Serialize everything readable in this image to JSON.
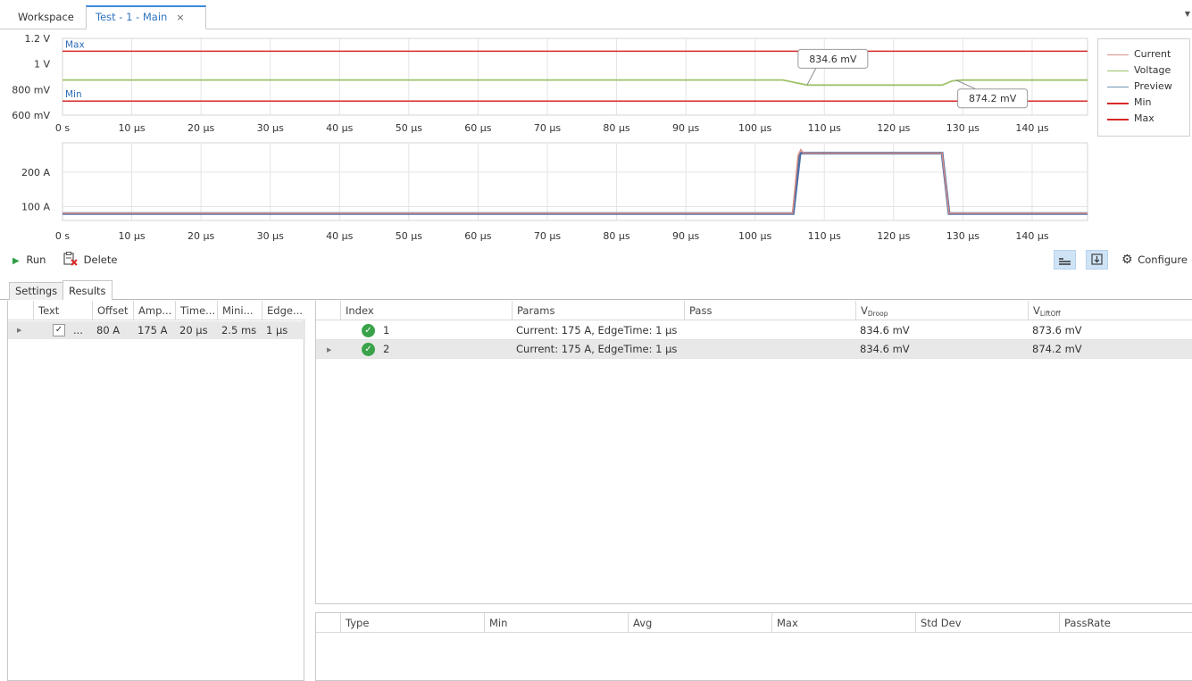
{
  "tabs": {
    "workspace": "Workspace",
    "main": "Test - 1 - Main",
    "close": "×"
  },
  "legend": [
    {
      "name": "Current",
      "color": "#d98f84"
    },
    {
      "name": "Voltage",
      "color": "#9ec36a"
    },
    {
      "name": "Preview",
      "color": "#6f93b5"
    },
    {
      "name": "Min",
      "color": "#d62828"
    },
    {
      "name": "Max",
      "color": "#d62828"
    }
  ],
  "chart_data": [
    {
      "type": "line",
      "xlim": [
        0,
        148
      ],
      "x_ticks": [
        "0 s",
        "10 µs",
        "20 µs",
        "30 µs",
        "40 µs",
        "50 µs",
        "60 µs",
        "70 µs",
        "80 µs",
        "90 µs",
        "100 µs",
        "110 µs",
        "120 µs",
        "130 µs",
        "140 µs"
      ],
      "y_ticks": [
        {
          "label": "1.2 V",
          "v": 1.2
        },
        {
          "label": "1 V",
          "v": 1.0
        },
        {
          "label": "800 mV",
          "v": 0.8
        },
        {
          "label": "600 mV",
          "v": 0.6
        }
      ],
      "ylim": [
        0.6,
        1.2
      ],
      "limit_lines": [
        {
          "label": "Max",
          "v": 1.1
        },
        {
          "label": "Min",
          "v": 0.71
        }
      ],
      "series": [
        {
          "name": "Voltage",
          "x": [
            0,
            104,
            107.5,
            108,
            127,
            128.5,
            130,
            148
          ],
          "y": [
            0.875,
            0.875,
            0.835,
            0.835,
            0.835,
            0.868,
            0.874,
            0.874
          ]
        }
      ],
      "annotations": [
        {
          "text": "834.6 mV",
          "x": 107.5,
          "y": 0.835
        },
        {
          "text": "874.2 mV",
          "x": 129,
          "y": 0.874
        }
      ]
    },
    {
      "type": "line",
      "xlim": [
        0,
        148
      ],
      "x_ticks": [
        "0 s",
        "10 µs",
        "20 µs",
        "30 µs",
        "40 µs",
        "50 µs",
        "60 µs",
        "70 µs",
        "80 µs",
        "90 µs",
        "100 µs",
        "110 µs",
        "120 µs",
        "130 µs",
        "140 µs"
      ],
      "y_ticks": [
        {
          "label": "200 A",
          "v": 200
        },
        {
          "label": "100 A",
          "v": 100
        }
      ],
      "ylim": [
        60,
        285
      ],
      "series": [
        {
          "name": "Preview",
          "x": [
            0,
            105.5,
            106.5,
            127,
            128,
            148
          ],
          "y": [
            80,
            80,
            255,
            255,
            80,
            80
          ]
        },
        {
          "name": "Current",
          "x": [
            0,
            105.4,
            106.2,
            106.6,
            107,
            127,
            128,
            148
          ],
          "y": [
            81,
            81,
            248,
            265,
            255,
            255,
            81,
            81
          ]
        }
      ]
    }
  ],
  "toolbar": {
    "run": "Run",
    "delete": "Delete",
    "configure": "Configure"
  },
  "subtabs": {
    "settings": "Settings",
    "results": "Results"
  },
  "left_grid": {
    "columns": [
      "Text",
      "Offset",
      "Amp...",
      "Time...",
      "Mini...",
      "Edge..."
    ],
    "row": {
      "text": "...",
      "offset": "80 A",
      "amp": "175 A",
      "time": "20 µs",
      "mini": "2.5 ms",
      "edge": "1 µs"
    }
  },
  "results_grid": {
    "columns": [
      "Index",
      "Params",
      "Pass"
    ],
    "col_droop": {
      "base": "V",
      "sub": "Droop"
    },
    "col_liftoff": {
      "base": "V",
      "sub": "LiftOff"
    },
    "rows": [
      {
        "index": "1",
        "params": "Current: 175 A, EdgeTime: 1 µs",
        "droop": "834.6 mV",
        "liftoff": "873.6 mV"
      },
      {
        "index": "2",
        "params": "Current: 175 A, EdgeTime: 1 µs",
        "droop": "834.6 mV",
        "liftoff": "874.2 mV"
      }
    ]
  },
  "stats_grid": {
    "columns": [
      "Type",
      "Min",
      "Avg",
      "Max",
      "Std Dev",
      "PassRate"
    ]
  }
}
